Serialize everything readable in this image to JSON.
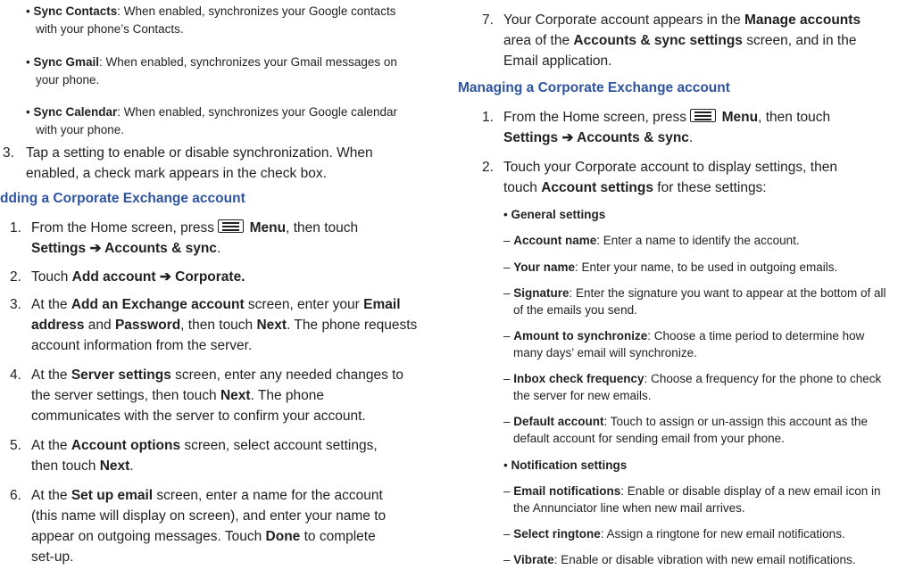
{
  "left": {
    "sync_bullets": [
      {
        "label": "Sync Contacts",
        "line1": ": When enabled, synchronizes your Google contacts",
        "line2": "with your phone’s Contacts."
      },
      {
        "label": "Sync Gmail",
        "line1": ": When enabled, synchronizes your Gmail messages on",
        "line2": "your phone."
      },
      {
        "label": "Sync Calendar",
        "line1": ": When enabled, synchronizes your Google calendar",
        "line2": "with your phone."
      }
    ],
    "step3": {
      "num": "3.",
      "line1": "Tap a setting to enable or disable synchronization. When",
      "line2": "enabled, a check mark appears in the check box."
    },
    "heading": "dding a Corporate Exchange account",
    "steps": [
      {
        "num": "1.",
        "a": "From the Home screen, press ",
        "menu": "Menu",
        "b": ", then touch",
        "l2": "Settings ➔ Accounts & sync",
        "l2tail": "."
      },
      {
        "num": "2.",
        "a": "Touch ",
        "bold": "Add account ➔ Corporate."
      },
      {
        "num": "3.",
        "a": "At the ",
        "b1": "Add an Exchange account",
        "c": " screen, enter your ",
        "b2": "Email",
        "l2b": "address",
        "l2a": " and ",
        "l2c": "Password",
        "l2d": ", then touch ",
        "l2e": "Next",
        "l2f": ". The phone requests",
        "l3": "account information from the server."
      },
      {
        "num": "4.",
        "a": "At the ",
        "b1": "Server settings",
        "c": " screen, enter any needed changes to",
        "l2": "the server settings, then touch ",
        "l2b": "Next",
        "l2c": ". The phone",
        "l3": "communicates with the server to confirm your account."
      },
      {
        "num": "5.",
        "a": "At the ",
        "b1": "Account options",
        "c": " screen, select account settings,",
        "l2": "then touch ",
        "l2b": "Next",
        "l2c": "."
      },
      {
        "num": "6.",
        "a": "At the ",
        "b1": "Set up email",
        "c": " screen, enter a name for the account",
        "l2": "(this name will display on screen), and enter your name to",
        "l3": "appear on outgoing messages. Touch ",
        "l3b": "Done",
        "l3c": " to complete",
        "l4": "set-up."
      }
    ]
  },
  "right": {
    "step7": {
      "num": "7.",
      "a": "Your Corporate account appears in the ",
      "b1": "Manage accounts",
      "l2": "area of the ",
      "l2b": "Accounts & sync settings",
      "l2c": " screen, and in the",
      "l3": "Email application."
    },
    "heading": "Managing a Corporate Exchange account",
    "step1": {
      "num": "1.",
      "a": "From the Home screen, press ",
      "menu": "Menu",
      "b": ", then touch",
      "l2": "Settings ➔ Accounts & sync",
      "l2tail": "."
    },
    "step2": {
      "num": "2.",
      "a": "Touch your Corporate account to display settings, then",
      "l2": "touch ",
      "l2b": "Account settings",
      "l2c": " for these settings:"
    },
    "general": "General settings",
    "general_items": [
      {
        "label": "Account name",
        "l1": ": Enter a name to identify the account.",
        "l2": ""
      },
      {
        "label": "Your name",
        "l1": ": Enter your name, to be used in outgoing emails.",
        "l2": ""
      },
      {
        "label": "Signature",
        "l1": ": Enter the signature you want to appear at the bottom of all",
        "l2": "of the emails you send."
      },
      {
        "label": "Amount to synchronize",
        "l1": ": Choose a time period to determine how",
        "l2": "many days’ email will synchronize."
      },
      {
        "label": "Inbox check frequency",
        "l1": ": Choose a frequency for the phone to check",
        "l2": "the server for new emails."
      },
      {
        "label": "Default account",
        "l1": ": Touch to assign or un-assign this account as the",
        "l2": "default account for sending email from your phone."
      }
    ],
    "notification": "Notification settings",
    "notification_items": [
      {
        "label": "Email notifications",
        "l1": ": Enable or disable display of a new email icon in",
        "l2": "the Annunciator line when new mail arrives."
      },
      {
        "label": "Select ringtone",
        "l1": ": Assign a ringtone for new email notifications.",
        "l2": ""
      },
      {
        "label": "Vibrate",
        "l1": ": Enable or disable vibration with new email notifications.",
        "l2": ""
      }
    ]
  }
}
